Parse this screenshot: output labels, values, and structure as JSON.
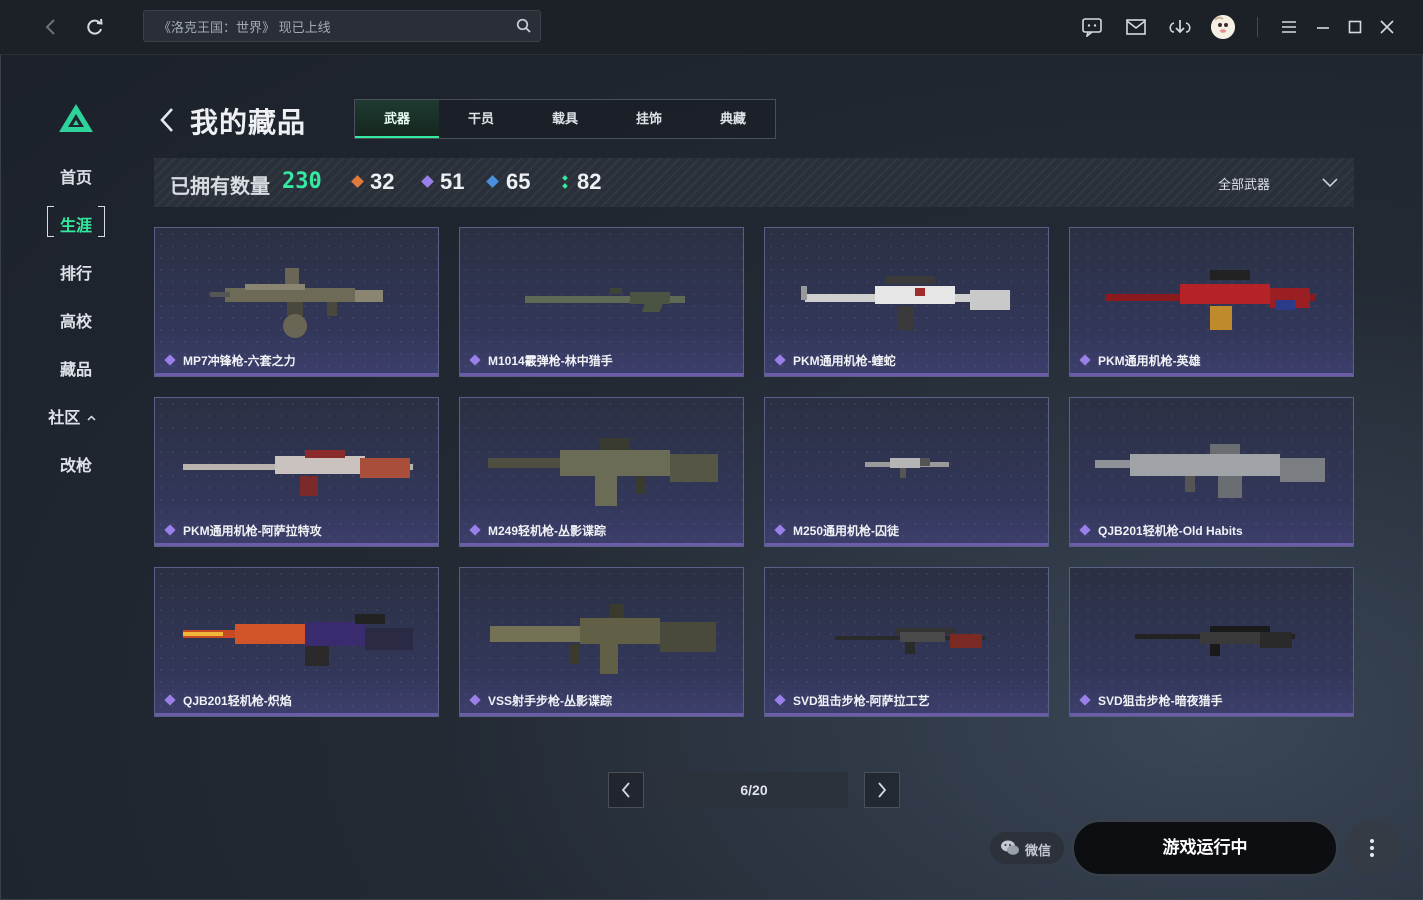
{
  "search": {
    "placeholder": "《洛克王国：世界》 现已上线"
  },
  "sidebar": {
    "items": [
      {
        "label": "首页",
        "active": false
      },
      {
        "label": "生涯",
        "active": true
      },
      {
        "label": "排行",
        "active": false
      },
      {
        "label": "高校",
        "active": false
      },
      {
        "label": "藏品",
        "active": false
      },
      {
        "label": "社区",
        "active": false
      },
      {
        "label": "改枪",
        "active": false
      }
    ]
  },
  "header": {
    "title": "我的藏品",
    "tabs": [
      {
        "label": "武器",
        "active": true
      },
      {
        "label": "干员",
        "active": false
      },
      {
        "label": "载具",
        "active": false
      },
      {
        "label": "挂饰",
        "active": false
      },
      {
        "label": "典藏",
        "active": false
      }
    ]
  },
  "stats": {
    "owned_label": "已拥有数量",
    "owned_total": "230",
    "tiers": [
      {
        "value": "32",
        "color": "#e07a3c"
      },
      {
        "value": "51",
        "color": "#9b7fe8"
      },
      {
        "value": "65",
        "color": "#4a8fe0"
      },
      {
        "value": "82",
        "color": "#34e9a0"
      }
    ],
    "filter_label": "全部武器"
  },
  "items": [
    {
      "name": "MP7冲锋枪-六套之力",
      "palette": "#8a8570"
    },
    {
      "name": "M1014霰弹枪-林中猎手",
      "palette": "#5e6a55"
    },
    {
      "name": "PKM通用机枪-蝰蛇",
      "palette": "#d8d8d8"
    },
    {
      "name": "PKM通用机枪-英雄",
      "palette": "#b52228"
    },
    {
      "name": "PKM通用机枪-阿萨拉特攻",
      "palette": "#b9b3b0"
    },
    {
      "name": "M249轻机枪-丛影谍踪",
      "palette": "#6b6c55"
    },
    {
      "name": "M250通用机枪-囚徒",
      "palette": "#9a9a9a"
    },
    {
      "name": "QJB201轻机枪-Old Habits",
      "palette": "#a0a3a8"
    },
    {
      "name": "QJB201轻机枪-炽焰",
      "palette": "#d2542a"
    },
    {
      "name": "VSS射手步枪-丛影谍踪",
      "palette": "#747255"
    },
    {
      "name": "SVD狙击步枪-阿萨拉工艺",
      "palette": "#7a2a22"
    },
    {
      "name": "SVD狙击步枪-暗夜猎手",
      "palette": "#3a3a3a"
    }
  ],
  "pagination": {
    "current": "6/20"
  },
  "footer": {
    "wechat_label": "微信",
    "play_label": "游戏运行中"
  },
  "colors": {
    "accent": "#34e9a0",
    "rarity_purple": "#9b7fe8"
  }
}
